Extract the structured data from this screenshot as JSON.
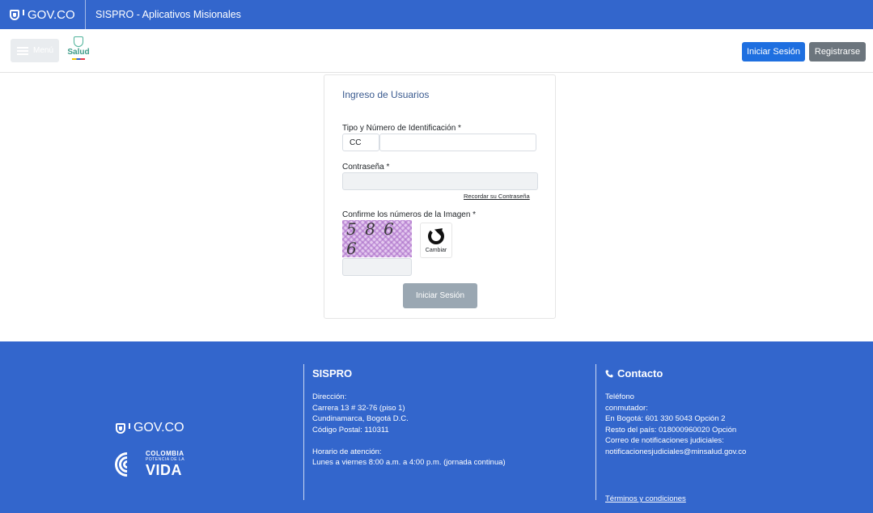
{
  "gov_bar": {
    "logo_text": "GOV.CO",
    "app_title": "SISPRO - Aplicativos Misionales"
  },
  "header": {
    "menu_label": "Menú",
    "brand_name": "Salud",
    "login_label": "Iniciar Sesión",
    "register_label": "Registrarse"
  },
  "login": {
    "title": "Ingreso de Usuarios",
    "id_label": "Tipo y Número de Identificación *",
    "id_type_value": "CC",
    "id_number_value": "",
    "password_label": "Contraseña *",
    "password_value": "",
    "forgot_link": "Recordar su Contraseña",
    "captcha_label": "Confirme los números de la Imagen *",
    "captcha_text": "5 8 6 6",
    "change_label": "Cambiar",
    "captcha_input_value": "",
    "submit_label": "Iniciar Sesión"
  },
  "footer": {
    "logo_text": "GOV.CO",
    "cv_line1": "COLOMBIA",
    "cv_line2": "POTENCIA DE LA",
    "cv_line3": "VIDA",
    "sispro": {
      "title": "SISPRO",
      "lines": [
        "Dirección:",
        "Carrera 13 # 32-76 (piso 1)",
        "Cundinamarca, Bogotá D.C.",
        "Código Postal: 110311",
        "",
        "Horario de atención:",
        "Lunes a viernes 8:00 a.m. a 4:00 p.m. (jornada continua)"
      ]
    },
    "contact": {
      "title": "Contacto",
      "lines": [
        "Teléfono",
        "conmutador:",
        "En Bogotá: 601 330 5043 Opción 2",
        "Resto del país: 018000960020 Opción",
        "Correo de notificaciones judiciales:",
        "notificacionesjudiciales@minsalud.gov.co"
      ]
    },
    "terms_link": "Términos y condiciones"
  },
  "colors": {
    "gov_blue": "#3366cc",
    "primary_button": "#1e6fe0",
    "secondary_button": "#6c757d",
    "disabled_button": "#9aa7b2"
  },
  "icons": [
    "govco-shield-icon",
    "hamburger-icon",
    "salud-emblem-icon",
    "refresh-icon",
    "phone-icon",
    "colombia-vida-logo"
  ]
}
